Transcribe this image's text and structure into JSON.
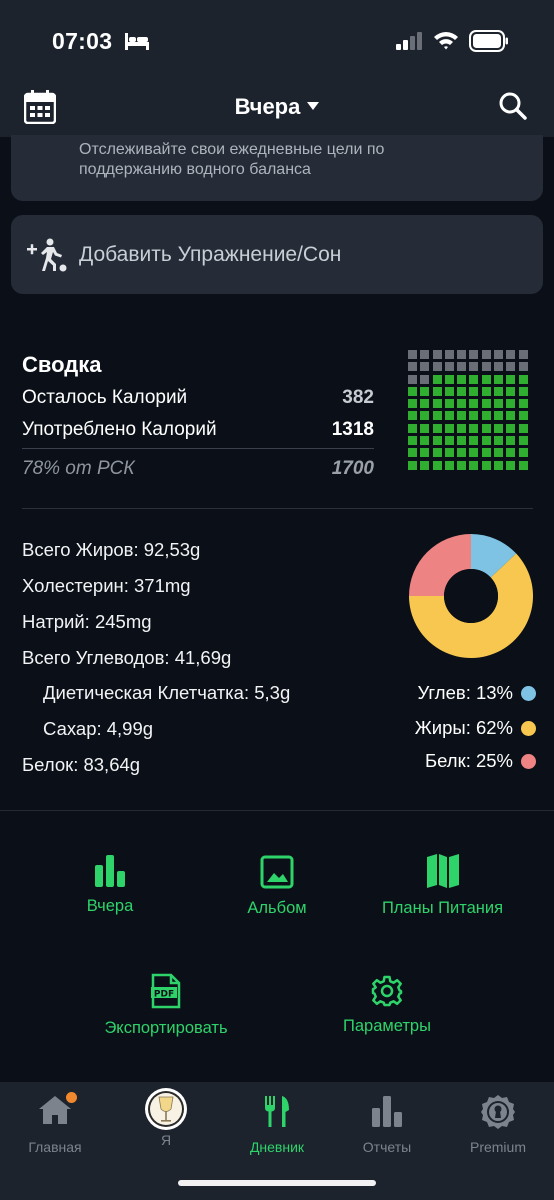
{
  "status_bar": {
    "time": "07:03",
    "icons": [
      "bed-icon",
      "signal-icon",
      "wifi-icon",
      "battery-icon"
    ]
  },
  "header": {
    "title": "Вчера",
    "left_icon": "calendar-icon",
    "right_icon": "search-icon"
  },
  "water_card": {
    "text": "Отслеживайте свои ежедневные цели по поддержанию водного баланса"
  },
  "exercise_card": {
    "label": "Добавить Упражнение/Сон",
    "icon": "add-exercise-icon"
  },
  "summary": {
    "title": "Сводка",
    "remaining_label": "Осталось Калорий",
    "remaining_value": "382",
    "consumed_label": "Употреблено Калорий",
    "consumed_value": "1318",
    "goal_label": "78% от РСК",
    "goal_value": "1700",
    "waffle": {
      "total_cells": 100,
      "consumed_cells": 78,
      "consumed_color": "#2fae2f",
      "remaining_color": "#6a6e77"
    }
  },
  "nutrients": {
    "fat": "Всего Жиров: 92,53g",
    "cholesterol": "Холестерин: 371mg",
    "sodium": "Натрий: 245mg",
    "carbs": "Всего Углеводов: 41,69g",
    "fiber": "Диетическая Клетчатка: 5,3g",
    "sugar": "Сахар: 4,99g",
    "protein": "Белок: 83,64g"
  },
  "macros": [
    {
      "label": "Углев: 13%",
      "percent": 13,
      "color": "#7fc3e4"
    },
    {
      "label": "Жиры: 62%",
      "percent": 62,
      "color": "#f8c74f"
    },
    {
      "label": "Белк: 25%",
      "percent": 25,
      "color": "#ee8383"
    }
  ],
  "actions": {
    "yesterday": "Вчера",
    "album": "Альбом",
    "meal_plans": "Планы Питания",
    "export": "Экспортировать",
    "settings": "Параметры"
  },
  "tabs": {
    "home": "Главная",
    "me": "Я",
    "diary": "Дневник",
    "reports": "Отчеты",
    "premium": "Premium"
  },
  "colors": {
    "accent": "#2ed36a",
    "background": "#0b1018",
    "card": "#252c37",
    "notification": "#f0892e"
  }
}
